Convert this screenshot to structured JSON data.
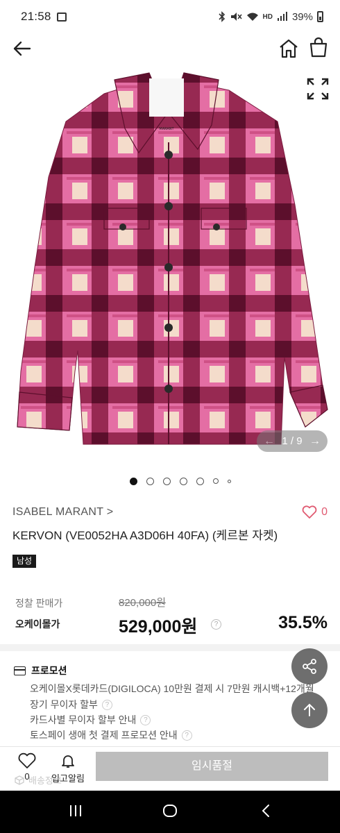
{
  "status_bar": {
    "time": "21:58",
    "battery": "39%",
    "hd_label": "HD"
  },
  "header": {
    "back_icon": "arrow-left-icon",
    "home_icon": "home-icon",
    "bag_icon": "shopping-bag-icon"
  },
  "gallery": {
    "counter": "1 / 9",
    "current": 1,
    "total": 9,
    "dots": 7,
    "active_dot": 0,
    "image_watermark": "MARANT"
  },
  "product": {
    "brand": "ISABEL MARANT >",
    "wish_count": "0",
    "title": "KERVON (VE0052HA A3D06H 40FA) (케르본 자켓)",
    "tag": "남성"
  },
  "price": {
    "list_label": "정찰 판매가",
    "list_price": "820,000원",
    "sale_label": "오케이몰가",
    "sale_price": "529,000원",
    "help": "?",
    "discount": "35.5%"
  },
  "promotion": {
    "title": "프로모션",
    "lines": [
      "오케이몰X롯데카드(DIGILOCA) 10만원 결제 시 7만원 캐시백+12개월",
      "장기 무이자 할부",
      "카드사별 무이자 할부 안내",
      "토스페이 생애 첫 결제 프로모션 안내"
    ],
    "help": "?"
  },
  "bottom_bar": {
    "like_count": "0",
    "notify_label": "입고알림",
    "soldout_label": "임시품절",
    "ghost_label": "배송정보"
  },
  "colors": {
    "accent_heart": "#e05a71",
    "soldout_bg": "#bdbdbd",
    "check_dark": "#8a1d44",
    "check_pink": "#e46ea4",
    "check_cream": "#f4dccb"
  }
}
